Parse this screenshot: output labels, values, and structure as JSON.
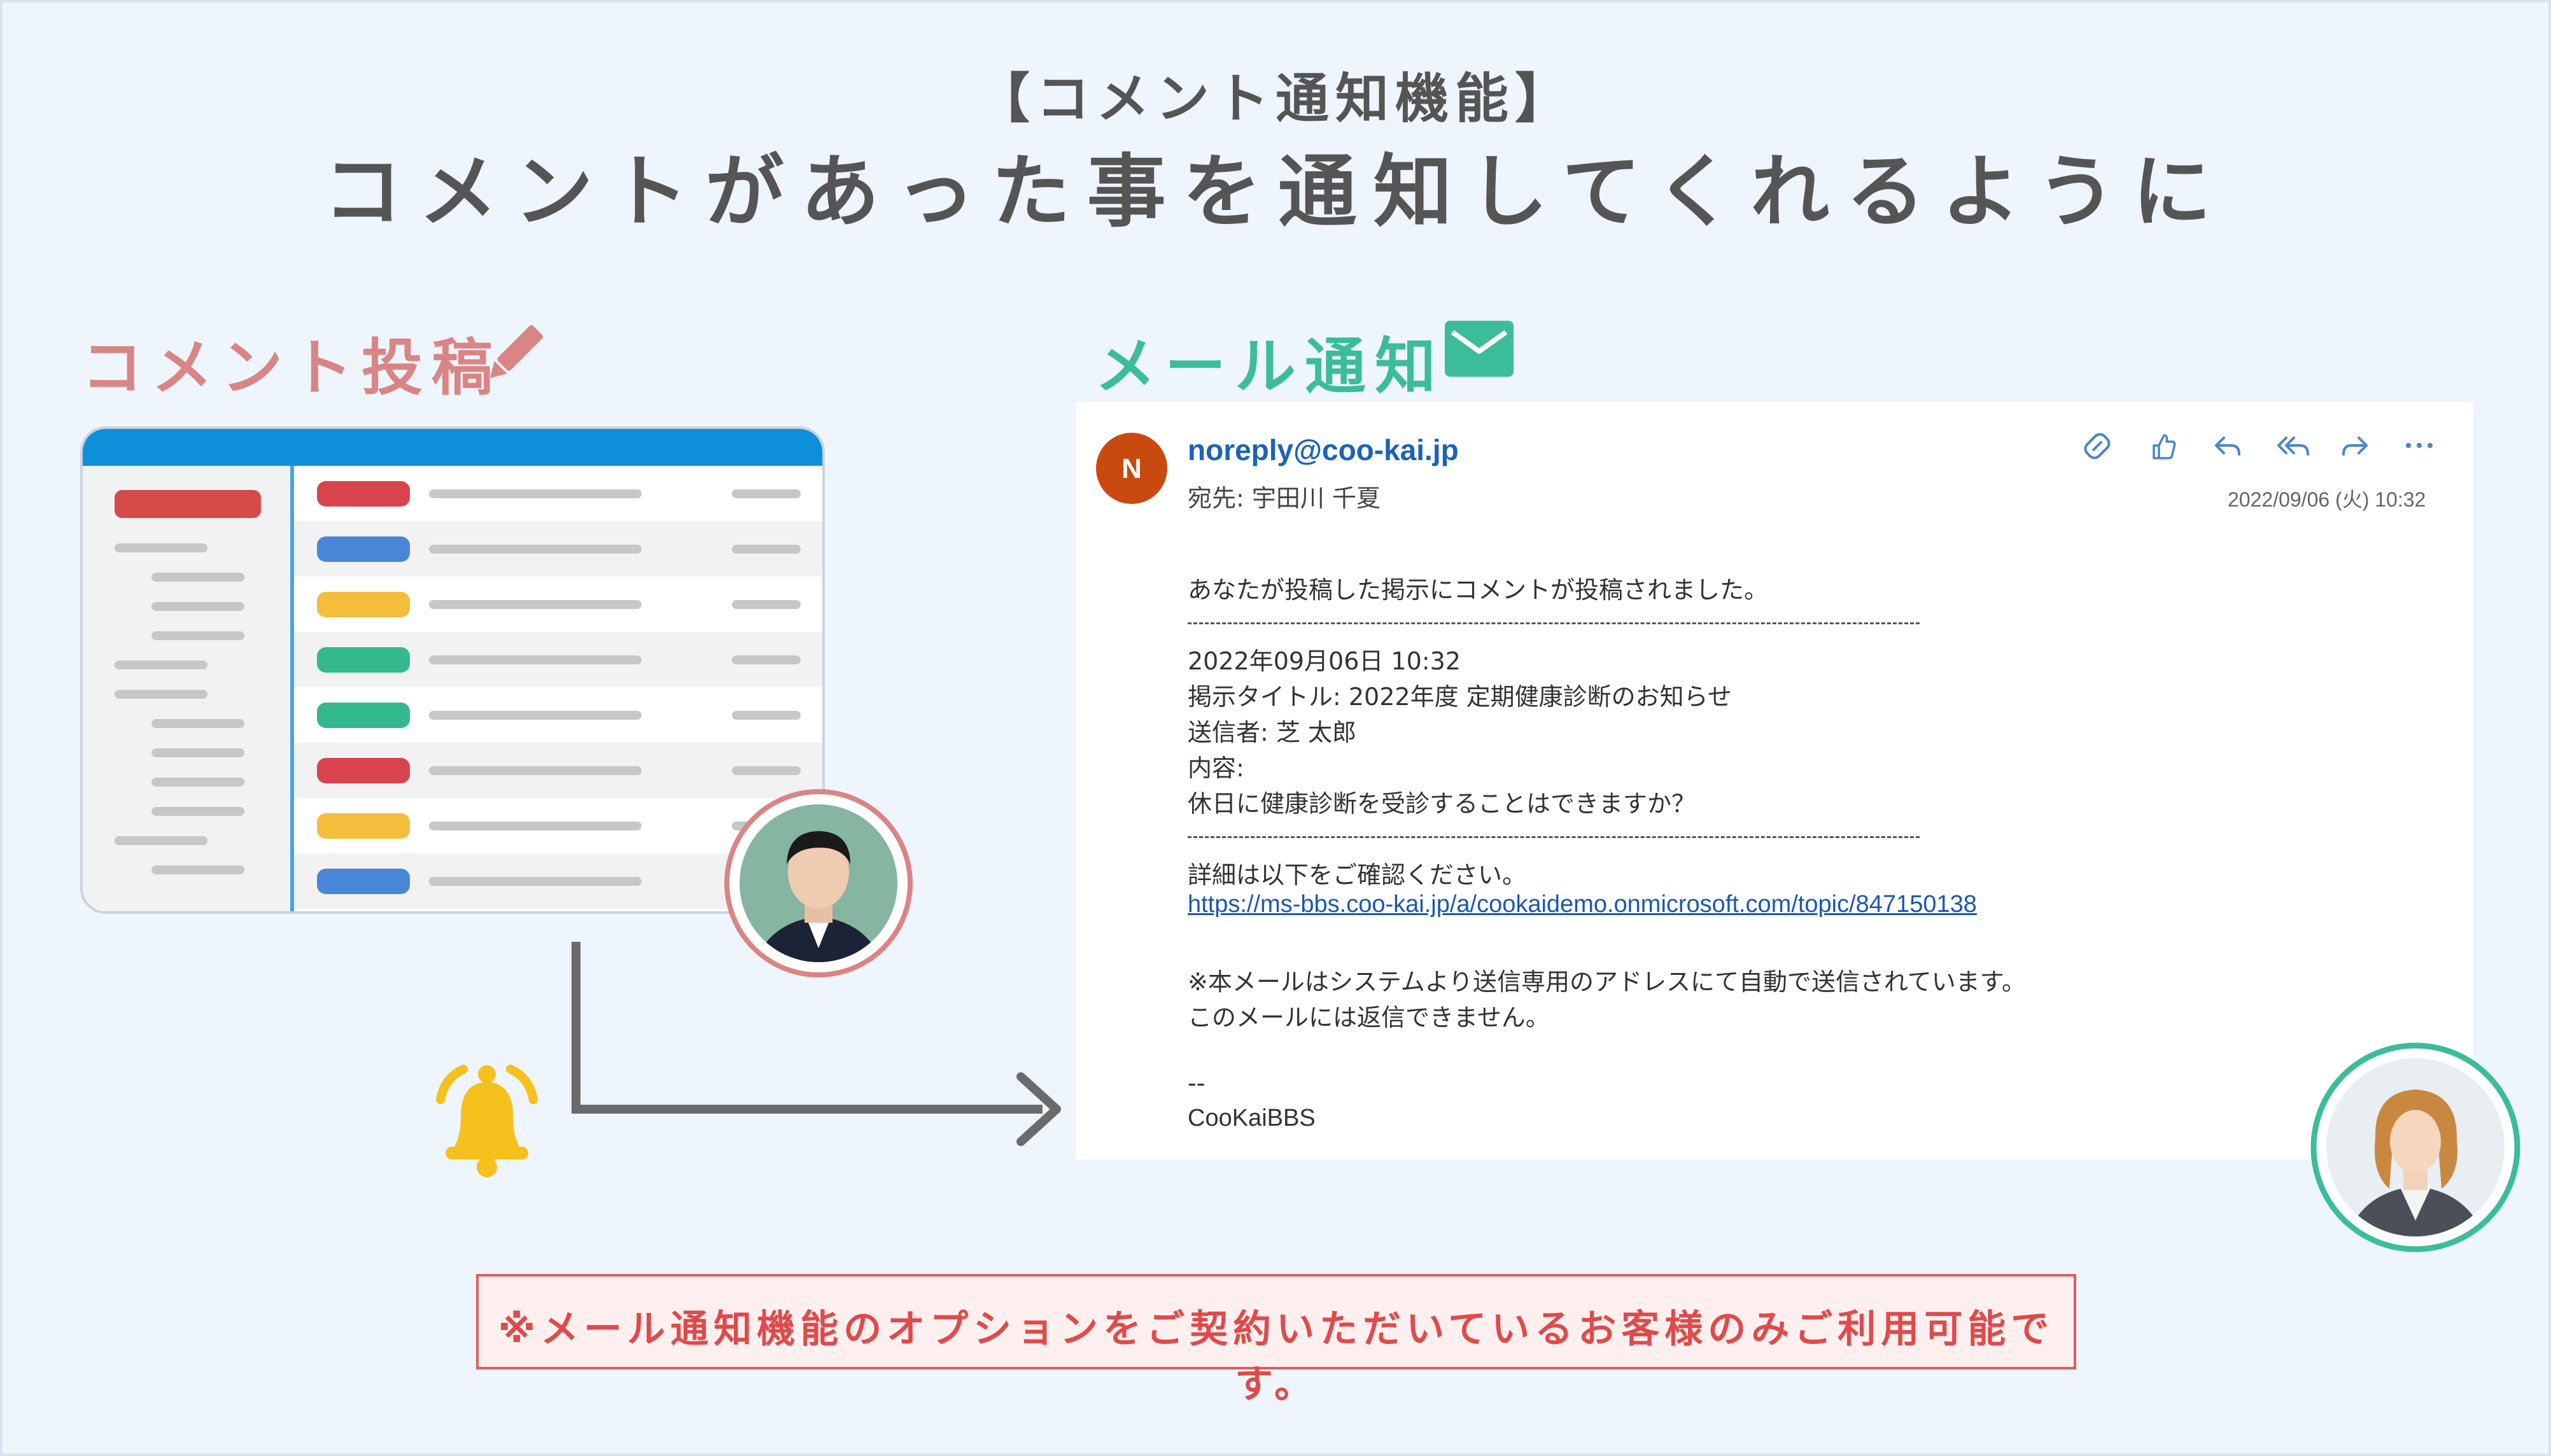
{
  "header": {
    "subtitle": "【コメント通知機能】",
    "title": "コメントがあった事を通知してくれるように"
  },
  "left_section": {
    "title": "コメント投稿",
    "icon": "pencil-icon",
    "pill_colors": [
      "#d9434e",
      "#4a86d8",
      "#f5bd3c",
      "#34b88e",
      "#34b88e",
      "#d9434e",
      "#f5bd3c",
      "#4a86d8"
    ]
  },
  "right_section": {
    "title": "メール通知",
    "icon": "envelope-icon"
  },
  "email": {
    "avatar_letter": "N",
    "sender": "noreply@coo-kai.jp",
    "to": "宛先:  宇田川 千夏",
    "date": "2022/09/06 (火) 10:32",
    "toolbar_icons": [
      "translate-icon",
      "like-icon",
      "reply-icon",
      "reply-all-icon",
      "forward-icon",
      "more-icon"
    ],
    "lines": {
      "l1": "あなたが投稿した掲示にコメントが投稿されました。",
      "l2": "2022年09月06日 10:32",
      "l3": "掲示タイトル: 2022年度 定期健康診断のお知らせ",
      "l4": "送信者: 芝 太郎",
      "l5": "内容:",
      "l6": "休日に健康診断を受診することはできますか？",
      "l7": "詳細は以下をご確認ください。",
      "link": "https://ms-bbs.coo-kai.jp/a/cookaidemo.onmicrosoft.com/topic/847150138",
      "l8": "※本メールはシステムより送信専用のアドレスにて自動で送信されています。",
      "l9": "このメールには返信できません。",
      "l10": "--",
      "l11": "CooKaiBBS"
    }
  },
  "note": "※メール通知機能のオプションをご契約いただいているお客様のみご利用可能です。",
  "colors": {
    "accent_red": "#d98585",
    "accent_green": "#3bbd9a",
    "note_red": "#e04a4a"
  }
}
